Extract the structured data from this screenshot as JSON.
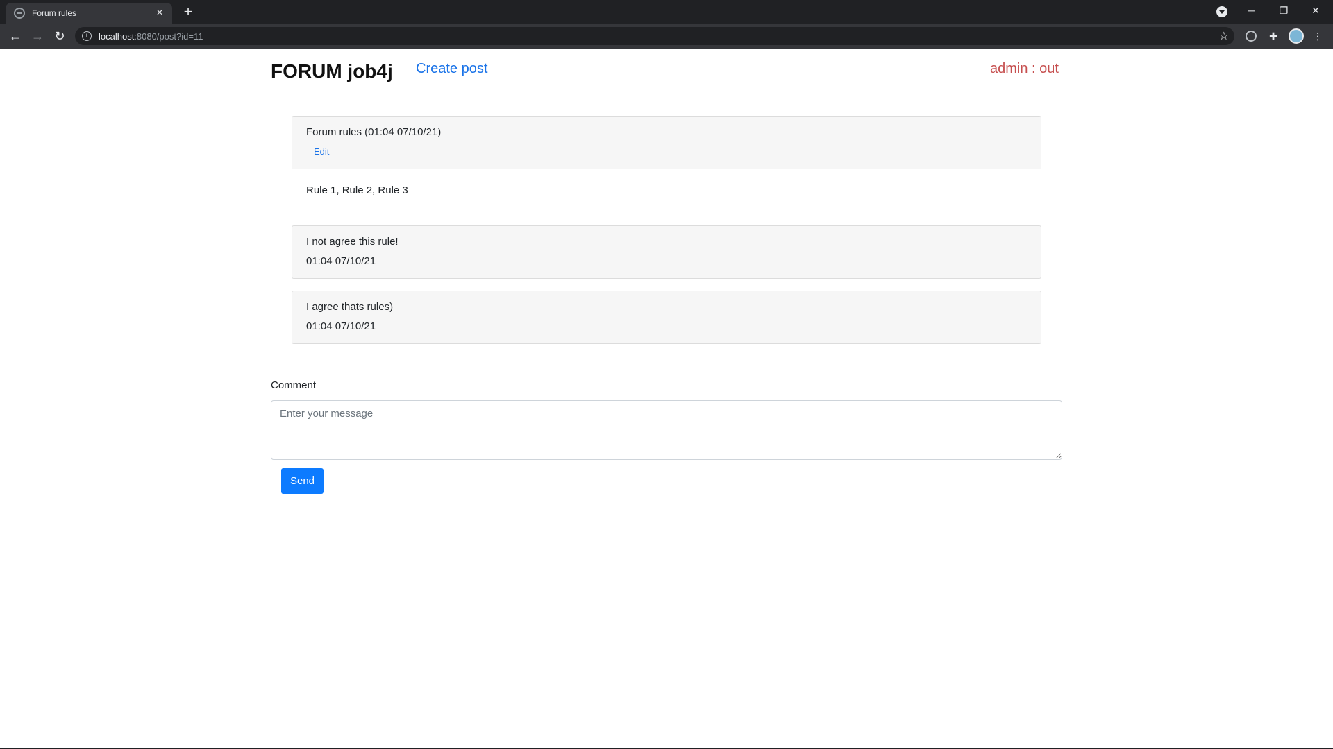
{
  "browser": {
    "tab_title": "Forum rules",
    "tab_close": "×",
    "new_tab": "+",
    "url_host": "localhost",
    "url_rest": ":8080/post?id=11",
    "controls": {
      "minimize": "─",
      "restore": "❐",
      "close": "✕"
    }
  },
  "header": {
    "brand": "FORUM job4j",
    "create_post": "Create post",
    "user": "admin : out"
  },
  "post": {
    "title": "Forum rules (01:04 07/10/21)",
    "edit": "Edit",
    "body": "Rule 1, Rule 2, Rule 3"
  },
  "comments": [
    {
      "message": "I not agree this rule!",
      "time": "01:04 07/10/21"
    },
    {
      "message": "I agree thats rules)",
      "time": "01:04 07/10/21"
    }
  ],
  "form": {
    "label": "Comment",
    "placeholder": "Enter your message",
    "send": "Send"
  },
  "colors": {
    "link": "#1a73e8",
    "user": "#c64f4f",
    "button": "#0d7bff"
  }
}
